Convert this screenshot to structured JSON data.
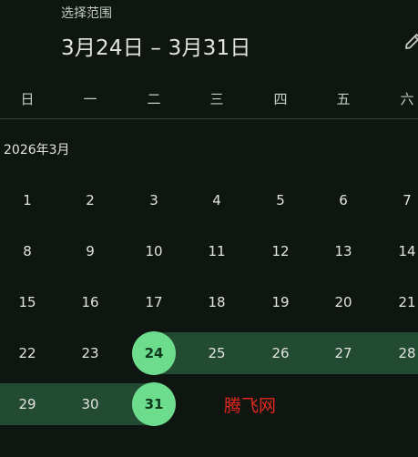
{
  "header": {
    "subtitle": "选择范围",
    "range_title": "3月24日 – 3月31日",
    "edit_icon": "pencil-edit-icon"
  },
  "weekdays": [
    "日",
    "一",
    "二",
    "三",
    "四",
    "五",
    "六"
  ],
  "calendar": {
    "month_label": "2026年3月",
    "weeks": [
      [
        "1",
        "2",
        "3",
        "4",
        "5",
        "6",
        "7"
      ],
      [
        "8",
        "9",
        "10",
        "11",
        "12",
        "13",
        "14"
      ],
      [
        "15",
        "16",
        "17",
        "18",
        "19",
        "20",
        "21"
      ],
      [
        "22",
        "23",
        "24",
        "25",
        "26",
        "27",
        "28"
      ],
      [
        "29",
        "30",
        "31",
        "",
        "",
        "",
        ""
      ]
    ],
    "range_start": "24",
    "range_end": "31"
  },
  "colors": {
    "background": "#0f1612",
    "range_band": "#234a32",
    "selected_circle": "#6ddc8d",
    "watermark": "#e0281f"
  },
  "watermark": "腾飞网"
}
